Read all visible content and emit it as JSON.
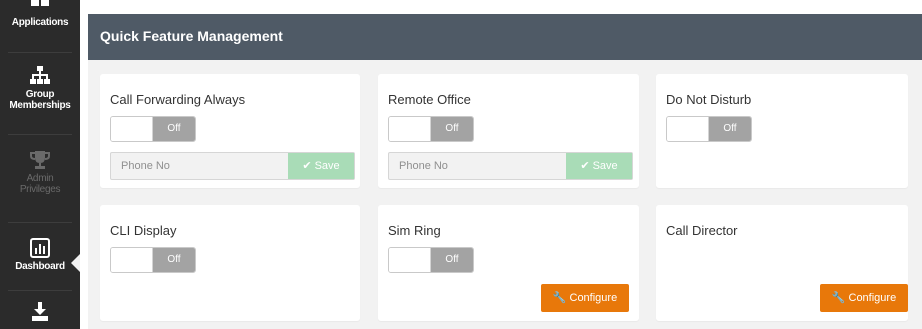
{
  "sidebar": {
    "items": [
      {
        "label": "Applications",
        "icon": "grid-icon"
      },
      {
        "label": "Group Memberships",
        "icon": "sitemap-icon"
      },
      {
        "label": "Admin Privileges",
        "icon": "trophy-icon"
      },
      {
        "label": "Dashboard",
        "icon": "bar-chart-icon"
      },
      {
        "label": "",
        "icon": "download-icon"
      }
    ]
  },
  "header": {
    "title": "Quick Feature Management"
  },
  "cards": {
    "call_forwarding": {
      "title": "Call Forwarding Always",
      "toggle": "Off",
      "placeholder": "Phone No",
      "save": "Save"
    },
    "remote_office": {
      "title": "Remote Office",
      "toggle": "Off",
      "placeholder": "Phone No",
      "save": "Save"
    },
    "dnd": {
      "title": "Do Not Disturb",
      "toggle": "Off"
    },
    "cli_display": {
      "title": "CLI Display",
      "toggle": "Off"
    },
    "sim_ring": {
      "title": "Sim Ring",
      "toggle": "Off",
      "configure": "Configure"
    },
    "call_director": {
      "title": "Call Director",
      "configure": "Configure"
    }
  },
  "colors": {
    "sidebar_bg": "#2b2b2b",
    "header_bg": "#4f5a66",
    "save_green": "#a9dcb7",
    "configure_orange": "#e8780a",
    "toggle_off": "#a3a3a3"
  }
}
